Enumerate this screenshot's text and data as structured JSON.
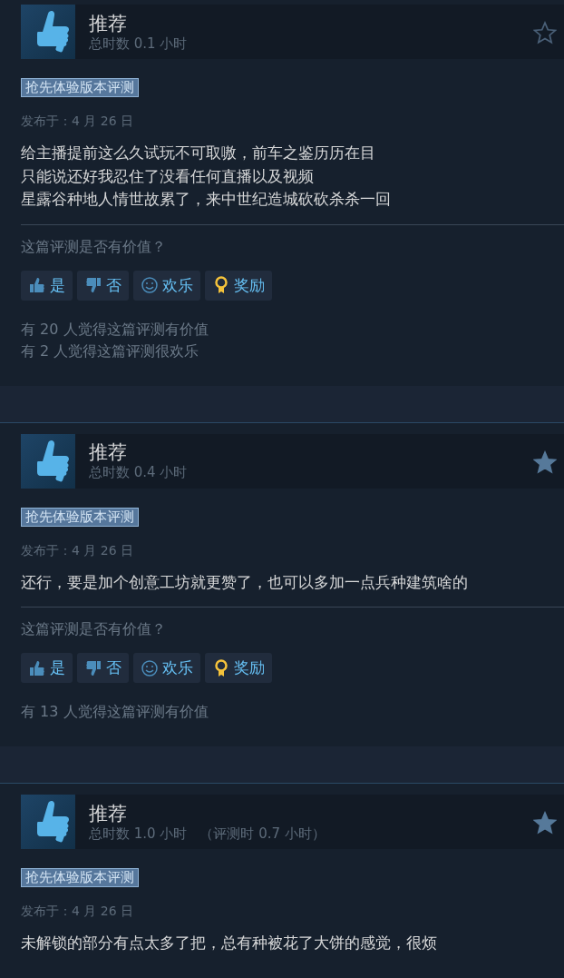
{
  "reviews": [
    {
      "title": "推荐",
      "hours": "总时数 0.1 小时",
      "starred": false,
      "tag": "抢先体验版本评测",
      "date": "发布于：4 月 26 日",
      "body": [
        "给主播提前这么久试玩不可取嗷，前车之鉴历历在目",
        "只能说还好我忍住了没看任何直播以及视频",
        "星露谷种地人情世故累了，来中世纪造城砍砍杀杀一回"
      ],
      "question": "这篇评测是否有价值？",
      "buttons": [
        {
          "kind": "yes",
          "label": "是"
        },
        {
          "kind": "no",
          "label": "否"
        },
        {
          "kind": "funny",
          "label": "欢乐"
        },
        {
          "kind": "award",
          "label": "奖励"
        }
      ],
      "counts": [
        "有 20 人觉得这篇评测有价值",
        "有 2 人觉得这篇评测很欢乐"
      ]
    },
    {
      "title": "推荐",
      "hours": "总时数 0.4 小时",
      "starred": true,
      "tag": "抢先体验版本评测",
      "date": "发布于：4 月 26 日",
      "body": [
        "还行，要是加个创意工坊就更赞了，也可以多加一点兵种建筑啥的"
      ],
      "question": "这篇评测是否有价值？",
      "buttons": [
        {
          "kind": "yes",
          "label": "是"
        },
        {
          "kind": "no",
          "label": "否"
        },
        {
          "kind": "funny",
          "label": "欢乐"
        },
        {
          "kind": "award",
          "label": "奖励"
        }
      ],
      "counts": [
        "有 13 人觉得这篇评测有价值"
      ]
    },
    {
      "title": "推荐",
      "hours": "总时数 1.0 小时",
      "hours_at_review": "（评测时 0.7 小时）",
      "starred": true,
      "tag": "抢先体验版本评测",
      "date": "发布于：4 月 26 日",
      "body": [
        "未解锁的部分有点太多了把，总有种被花了大饼的感觉，很烦"
      ]
    }
  ]
}
